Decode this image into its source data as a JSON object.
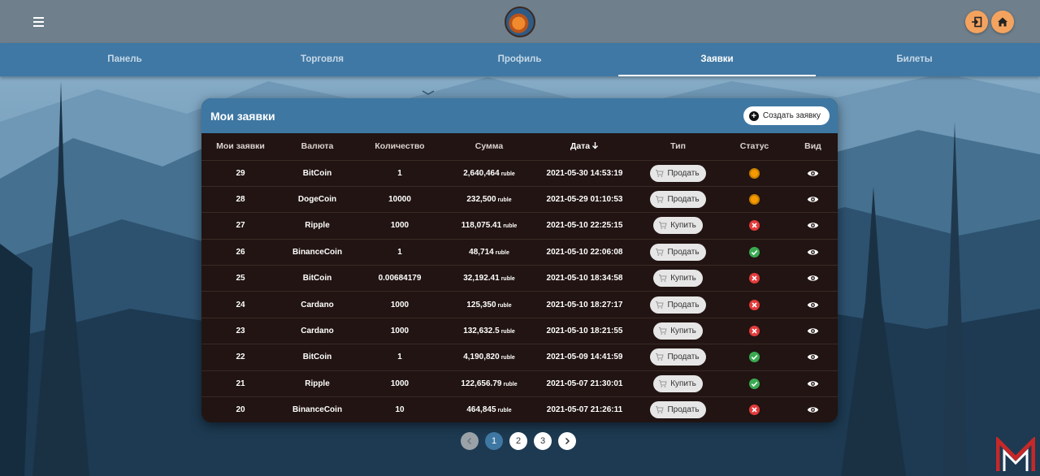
{
  "header": {
    "menu_icon": "menu-icon",
    "logo": "app-logo",
    "login_icon": "login-icon",
    "home_icon": "home-icon"
  },
  "tabs": [
    {
      "label": "Панель",
      "active": false
    },
    {
      "label": "Торговля",
      "active": false
    },
    {
      "label": "Профиль",
      "active": false
    },
    {
      "label": "Заявки",
      "active": true
    },
    {
      "label": "Билеты",
      "active": false
    }
  ],
  "orders": {
    "title": "Мои заявки",
    "create_label": "Создать заявку",
    "columns": [
      "Мои заявки",
      "Валюта",
      "Количество",
      "Сумма",
      "Дата",
      "Тип",
      "Статус",
      "Вид"
    ],
    "sort_column": "Дата",
    "unit": "ruble",
    "rows": [
      {
        "id": "29",
        "currency": "BitCoin",
        "quantity": "1",
        "sum": "2,640,464",
        "date": "2021-05-30 14:53:19",
        "type": "Продать",
        "status": "pending"
      },
      {
        "id": "28",
        "currency": "DogeCoin",
        "quantity": "10000",
        "sum": "232,500",
        "date": "2021-05-29 01:10:53",
        "type": "Продать",
        "status": "pending"
      },
      {
        "id": "27",
        "currency": "Ripple",
        "quantity": "1000",
        "sum": "118,075.41",
        "date": "2021-05-10 22:25:15",
        "type": "Купить",
        "status": "cancelled"
      },
      {
        "id": "26",
        "currency": "BinanceCoin",
        "quantity": "1",
        "sum": "48,714",
        "date": "2021-05-10 22:06:08",
        "type": "Продать",
        "status": "done"
      },
      {
        "id": "25",
        "currency": "BitCoin",
        "quantity": "0.00684179",
        "sum": "32,192.41",
        "date": "2021-05-10 18:34:58",
        "type": "Купить",
        "status": "cancelled"
      },
      {
        "id": "24",
        "currency": "Cardano",
        "quantity": "1000",
        "sum": "125,350",
        "date": "2021-05-10 18:27:17",
        "type": "Продать",
        "status": "cancelled"
      },
      {
        "id": "23",
        "currency": "Cardano",
        "quantity": "1000",
        "sum": "132,632.5",
        "date": "2021-05-10 18:21:55",
        "type": "Купить",
        "status": "cancelled"
      },
      {
        "id": "22",
        "currency": "BitCoin",
        "quantity": "1",
        "sum": "4,190,820",
        "date": "2021-05-09 14:41:59",
        "type": "Продать",
        "status": "done"
      },
      {
        "id": "21",
        "currency": "Ripple",
        "quantity": "1000",
        "sum": "122,656.79",
        "date": "2021-05-07 21:30:01",
        "type": "Купить",
        "status": "done"
      },
      {
        "id": "20",
        "currency": "BinanceCoin",
        "quantity": "10",
        "sum": "464,845",
        "date": "2021-05-07 21:26:11",
        "type": "Продать",
        "status": "cancelled"
      }
    ]
  },
  "pagination": {
    "pages": [
      "1",
      "2",
      "3"
    ],
    "current": "1",
    "prev_icon": "chevron-left-icon",
    "next_icon": "chevron-right-icon"
  },
  "colors": {
    "topbar": "#6f7f8c",
    "tabs": "#3f78a4",
    "card": "#211412",
    "accent": "#f4a35f",
    "pending": "#f59b00",
    "cancelled": "#e33b3b",
    "done": "#3aaa52"
  }
}
